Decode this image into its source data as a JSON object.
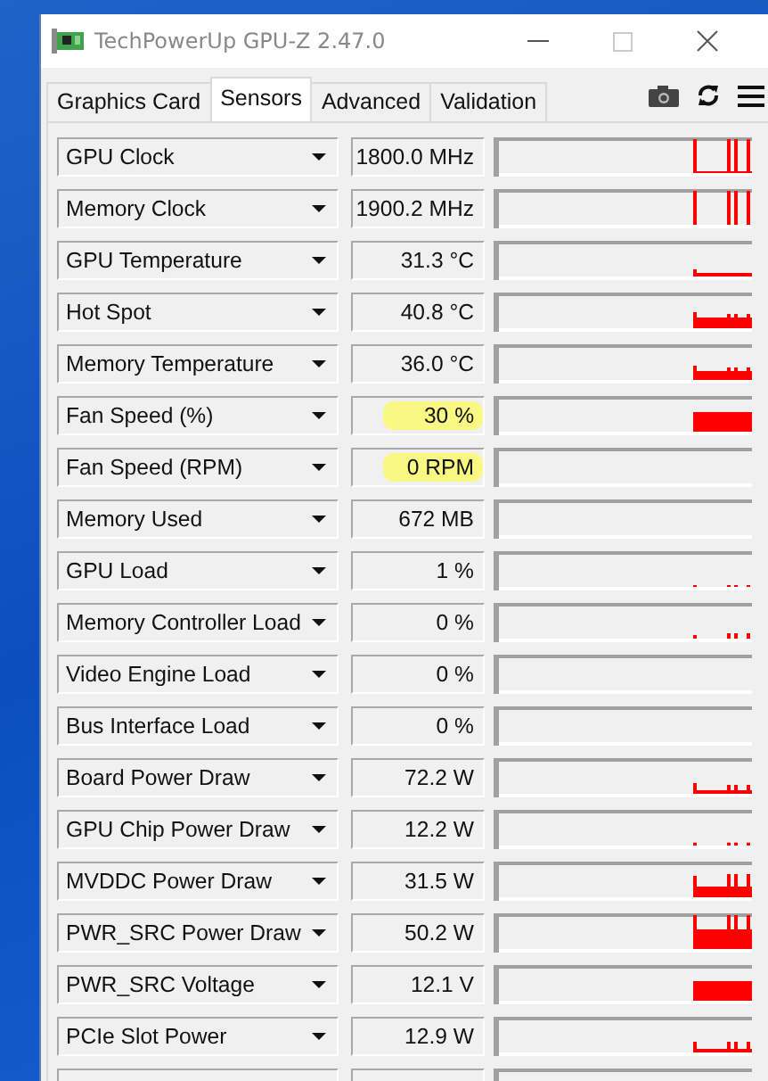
{
  "window": {
    "title": "TechPowerUp GPU-Z 2.47.0"
  },
  "tabs": [
    {
      "label": "Graphics Card",
      "selected": false
    },
    {
      "label": "Sensors",
      "selected": true
    },
    {
      "label": "Advanced",
      "selected": false
    },
    {
      "label": "Validation",
      "selected": false
    }
  ],
  "sensors": [
    {
      "name": "GPU Clock",
      "value": "1800.0 MHz",
      "highlighted": false
    },
    {
      "name": "Memory Clock",
      "value": "1900.2 MHz",
      "highlighted": false
    },
    {
      "name": "GPU Temperature",
      "value": "31.3 °C",
      "highlighted": false
    },
    {
      "name": "Hot Spot",
      "value": "40.8 °C",
      "highlighted": false
    },
    {
      "name": "Memory Temperature",
      "value": "36.0 °C",
      "highlighted": false
    },
    {
      "name": "Fan Speed (%)",
      "value": "30 %",
      "highlighted": true
    },
    {
      "name": "Fan Speed (RPM)",
      "value": "0 RPM",
      "highlighted": true
    },
    {
      "name": "Memory Used",
      "value": "672 MB",
      "highlighted": false
    },
    {
      "name": "GPU Load",
      "value": "1 %",
      "highlighted": false
    },
    {
      "name": "Memory Controller Load",
      "value": "0 %",
      "highlighted": false
    },
    {
      "name": "Video Engine Load",
      "value": "0 %",
      "highlighted": false
    },
    {
      "name": "Bus Interface Load",
      "value": "0 %",
      "highlighted": false
    },
    {
      "name": "Board Power Draw",
      "value": "72.2 W",
      "highlighted": false
    },
    {
      "name": "GPU Chip Power Draw",
      "value": "12.2 W",
      "highlighted": false
    },
    {
      "name": "MVDDC Power Draw",
      "value": "31.5 W",
      "highlighted": false
    },
    {
      "name": "PWR_SRC Power Draw",
      "value": "50.2 W",
      "highlighted": false
    },
    {
      "name": "PWR_SRC Voltage",
      "value": "12.1 V",
      "highlighted": false
    },
    {
      "name": "PCIe Slot Power",
      "value": "12.9 W",
      "highlighted": false
    }
  ]
}
